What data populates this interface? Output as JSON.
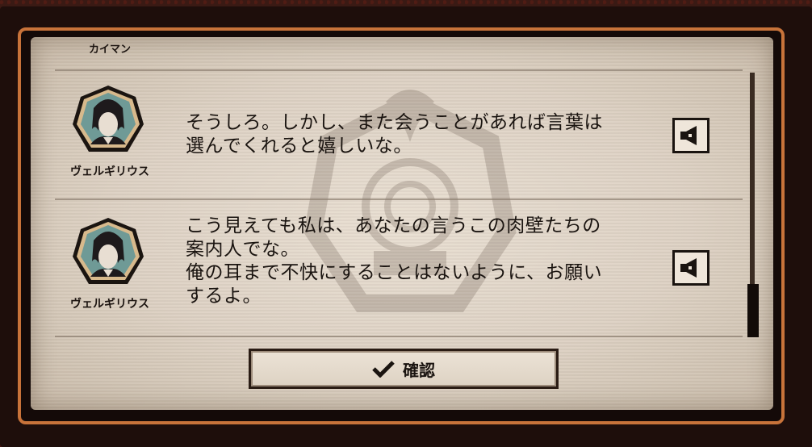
{
  "backlog": {
    "previous_speaker": "カイマン",
    "entries": [
      {
        "speaker": "ヴェルギリウス",
        "lines": [
          "そうしろ。しかし、また会うことがあれば言葉は",
          "選んでくれると嬉しいな。"
        ],
        "voice_icon": "speaker-icon"
      },
      {
        "speaker": "ヴェルギリウス",
        "lines": [
          "こう見えても私は、あなたの言うこの肉壁たちの",
          "案内人でな。",
          "俺の耳まで不快にすることはないように、お願い",
          "するよ。"
        ],
        "voice_icon": "speaker-icon"
      }
    ],
    "scroll_position": 1.0
  },
  "confirm": {
    "label": "確認",
    "icon": "checkmark-icon"
  },
  "colors": {
    "frame_accent": "#c8733a",
    "paper": "#e4d9cb",
    "ink": "#1a1410"
  }
}
